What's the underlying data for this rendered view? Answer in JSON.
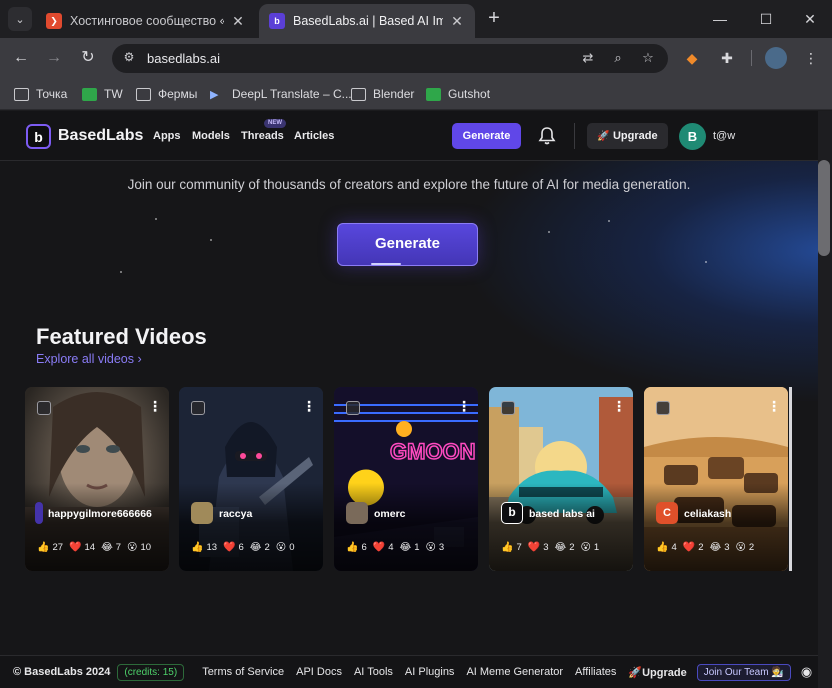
{
  "browser": {
    "tabs": [
      {
        "title": "Хостинговое сообщество «Tim",
        "favicon_color": "#e04a2f",
        "active": false
      },
      {
        "title": "BasedLabs.ai | Based AI Image &",
        "favicon_color": "#5b3fd6",
        "active": true
      }
    ],
    "url": "basedlabs.ai",
    "bookmarks": [
      {
        "label": "Точка",
        "icon": "folder-icon"
      },
      {
        "label": "TW",
        "icon": "green-plus-icon"
      },
      {
        "label": "Фермы",
        "icon": "folder-icon"
      },
      {
        "label": "DeepL Translate – C...",
        "icon": "deepl-icon"
      },
      {
        "label": "Blender",
        "icon": "folder-icon"
      },
      {
        "label": "Gutshot",
        "icon": "green-plus-icon"
      }
    ]
  },
  "site": {
    "brand": "BasedLabs",
    "logo_letter": "b",
    "nav": [
      "Apps",
      "Models",
      "Threads",
      "Articles"
    ],
    "new_badge": "NEW",
    "generate_label": "Generate",
    "upgrade_label": "Upgrade",
    "avatar_letter": "B",
    "user_name": "t@w",
    "tagline": "Join our community of thousands of creators and explore the future of AI for media generation.",
    "hero_button": "Generate",
    "section_title": "Featured Videos",
    "explore_link": "Explore all videos ›",
    "accent": "#6047e8"
  },
  "cards": [
    {
      "user": "happygilmore666666",
      "avatar_color": "#4433aa",
      "avatar_text": "",
      "art": "portrait-woman",
      "reactions": [
        {
          "e": "👍",
          "n": "27"
        },
        {
          "e": "❤️",
          "n": "14"
        },
        {
          "e": "😂",
          "n": "7"
        },
        {
          "e": "😮",
          "n": "10"
        }
      ]
    },
    {
      "user": "raccya",
      "avatar_color": "#a08a5a",
      "avatar_text": "",
      "art": "cyber-robot",
      "reactions": [
        {
          "e": "👍",
          "n": "13"
        },
        {
          "e": "❤️",
          "n": "6"
        },
        {
          "e": "😂",
          "n": "2"
        },
        {
          "e": "😮",
          "n": "0"
        }
      ]
    },
    {
      "user": "omerc",
      "avatar_color": "#7a6a5a",
      "avatar_text": "",
      "art": "neon-gmoon",
      "reactions": [
        {
          "e": "👍",
          "n": "6"
        },
        {
          "e": "❤️",
          "n": "4"
        },
        {
          "e": "😂",
          "n": "1"
        },
        {
          "e": "😮",
          "n": "3"
        }
      ]
    },
    {
      "user": "based labs ai",
      "avatar_color": "#0d0d10",
      "avatar_text": "b",
      "art": "car-street",
      "reactions": [
        {
          "e": "👍",
          "n": "7"
        },
        {
          "e": "❤️",
          "n": "3"
        },
        {
          "e": "😂",
          "n": "2"
        },
        {
          "e": "😮",
          "n": "1"
        }
      ]
    },
    {
      "user": "celiakash",
      "avatar_color": "#e0502a",
      "avatar_text": "C",
      "art": "desert-trucks",
      "reactions": [
        {
          "e": "👍",
          "n": "4"
        },
        {
          "e": "❤️",
          "n": "2"
        },
        {
          "e": "😂",
          "n": "3"
        },
        {
          "e": "😮",
          "n": "2"
        }
      ]
    }
  ],
  "footer": {
    "copyright": "© BasedLabs 2024",
    "credits": "(credits: 15)",
    "links": [
      "Terms of Service",
      "API Docs",
      "AI Tools",
      "AI Plugins",
      "AI Meme Generator",
      "Affiliates"
    ],
    "upgrade": "Upgrade",
    "join": "Join Our Team 🧑‍🔬"
  }
}
